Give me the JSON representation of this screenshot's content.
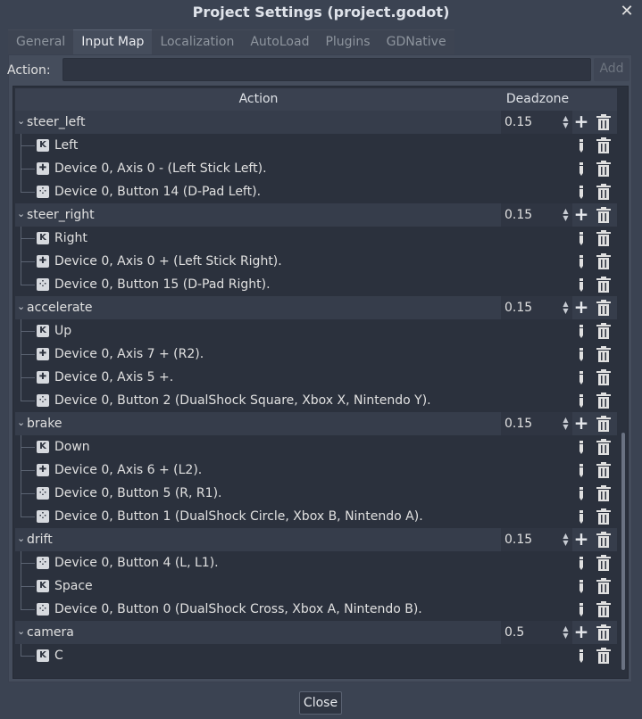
{
  "window": {
    "title": "Project Settings (project.godot)"
  },
  "tabs": [
    {
      "label": "General"
    },
    {
      "label": "Input Map"
    },
    {
      "label": "Localization"
    },
    {
      "label": "AutoLoad"
    },
    {
      "label": "Plugins"
    },
    {
      "label": "GDNative"
    }
  ],
  "action_bar": {
    "label": "Action:",
    "value": "",
    "add_label": "Add"
  },
  "table": {
    "col_action": "Action",
    "col_deadzone": "Deadzone"
  },
  "groups": [
    {
      "name": "steer_left",
      "deadzone": "0.15",
      "events": [
        {
          "icon": "keyboard-icon",
          "label": "Left"
        },
        {
          "icon": "joypad-axis-icon",
          "label": "Device 0, Axis 0 - (Left Stick Left)."
        },
        {
          "icon": "joypad-button-icon",
          "label": "Device 0, Button 14 (D-Pad Left)."
        }
      ]
    },
    {
      "name": "steer_right",
      "deadzone": "0.15",
      "events": [
        {
          "icon": "keyboard-icon",
          "label": "Right"
        },
        {
          "icon": "joypad-axis-icon",
          "label": "Device 0, Axis 0 + (Left Stick Right)."
        },
        {
          "icon": "joypad-button-icon",
          "label": "Device 0, Button 15 (D-Pad Right)."
        }
      ]
    },
    {
      "name": "accelerate",
      "deadzone": "0.15",
      "events": [
        {
          "icon": "keyboard-icon",
          "label": "Up"
        },
        {
          "icon": "joypad-axis-icon",
          "label": "Device 0, Axis 7 + (R2)."
        },
        {
          "icon": "joypad-axis-icon",
          "label": "Device 0, Axis 5 +."
        },
        {
          "icon": "joypad-button-icon",
          "label": "Device 0, Button 2 (DualShock Square, Xbox X, Nintendo Y)."
        }
      ]
    },
    {
      "name": "brake",
      "deadzone": "0.15",
      "events": [
        {
          "icon": "keyboard-icon",
          "label": "Down"
        },
        {
          "icon": "joypad-axis-icon",
          "label": "Device 0, Axis 6 + (L2)."
        },
        {
          "icon": "joypad-button-icon",
          "label": "Device 0, Button 5 (R, R1)."
        },
        {
          "icon": "joypad-button-icon",
          "label": "Device 0, Button 1 (DualShock Circle, Xbox B, Nintendo A)."
        }
      ]
    },
    {
      "name": "drift",
      "deadzone": "0.15",
      "events": [
        {
          "icon": "joypad-button-icon",
          "label": "Device 0, Button 4 (L, L1)."
        },
        {
          "icon": "keyboard-icon",
          "label": "Space"
        },
        {
          "icon": "joypad-button-icon",
          "label": "Device 0, Button 0 (DualShock Cross, Xbox A, Nintendo B)."
        }
      ]
    },
    {
      "name": "camera",
      "deadzone": "0.5",
      "events": [
        {
          "icon": "keyboard-icon",
          "label": "C"
        }
      ]
    }
  ],
  "footer": {
    "close_label": "Close"
  },
  "colors": {
    "background": "#3b4352",
    "tree_bg": "#2b313d",
    "group_row": "#363d4b"
  }
}
